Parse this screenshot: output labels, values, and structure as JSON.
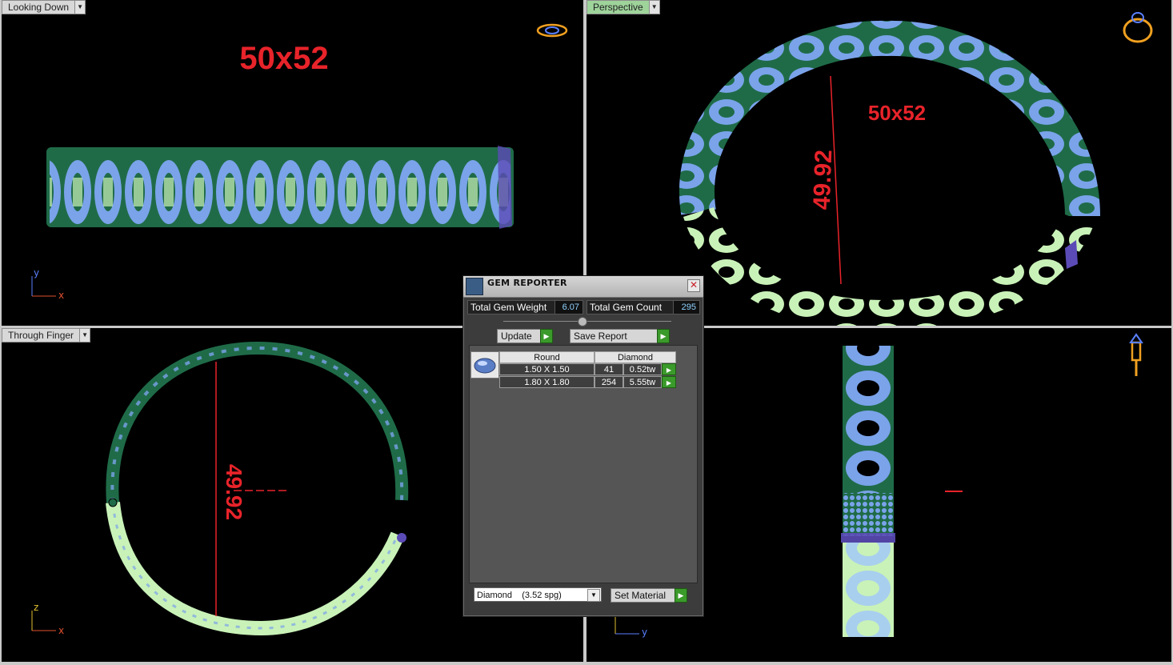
{
  "viewports": {
    "top_left": {
      "label": "Looking Down",
      "dimension": "50x52",
      "axes": [
        "y",
        "x"
      ]
    },
    "top_right": {
      "label": "Perspective",
      "dimension": "50x52",
      "diameter": "49.92"
    },
    "bottom_left": {
      "label": "Through Finger",
      "diameter": "49.92",
      "axes": [
        "z",
        "x"
      ]
    },
    "bottom_right": {
      "axes": [
        "y"
      ]
    }
  },
  "gem_reporter": {
    "title": "GEM REPORTER",
    "total_weight_label": "Total Gem Weight",
    "total_weight_value": "6.07",
    "total_count_label": "Total Gem Count",
    "total_count_value": "295",
    "update_label": "Update",
    "save_report_label": "Save Report",
    "table": {
      "shape": "Round",
      "material": "Diamond",
      "rows": [
        {
          "size": "1.50 X 1.50",
          "count": "41",
          "weight": "0.52tw"
        },
        {
          "size": "1.80 X 1.80",
          "count": "254",
          "weight": "5.55tw"
        }
      ]
    },
    "material_select_value": "Diamond    (3.52 spg)",
    "set_material_label": "Set Material"
  },
  "colors": {
    "dark_green": "#1f6b48",
    "blue": "#7aa3ea",
    "light_green": "#c9f2b8",
    "dimension_red": "#e8232a"
  }
}
